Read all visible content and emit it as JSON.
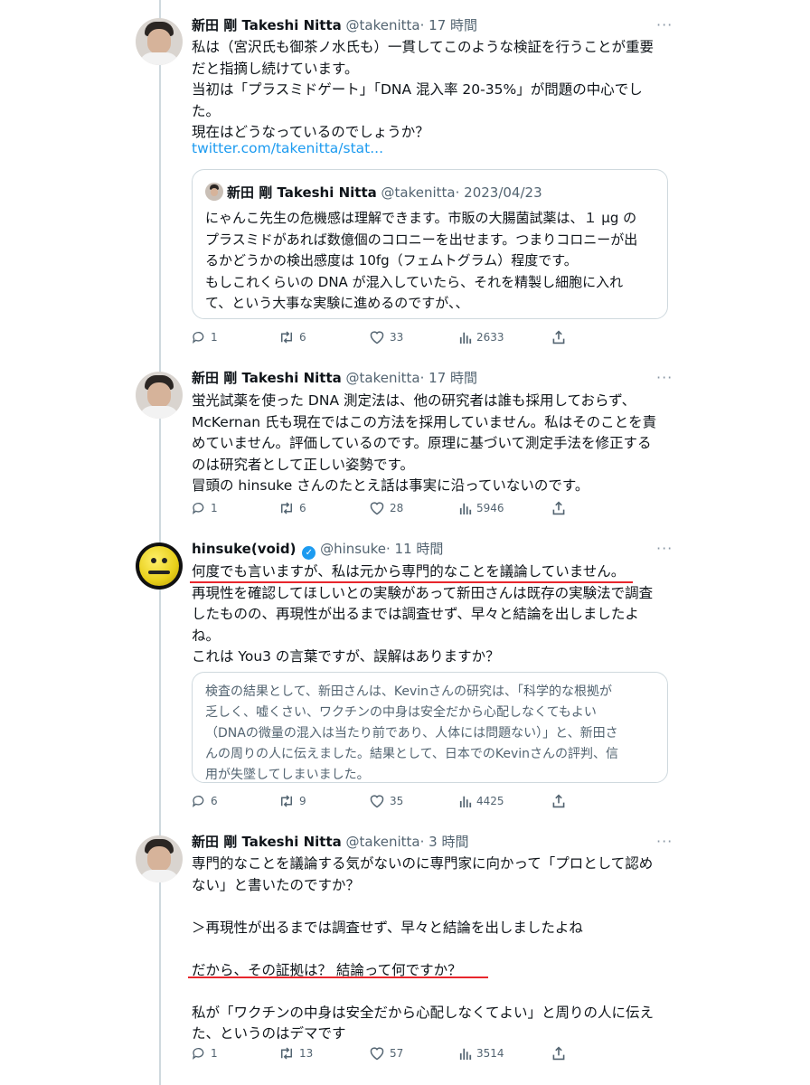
{
  "tweets": [
    {
      "name": "新田 剛 Takeshi Nitta",
      "handle": "@takenitta",
      "time": "· 17 時間",
      "text": "私は（宮沢氏も御茶ノ水氏も）一貫してこのような検証を行うことが重要\nだと指摘し続けています。\n当初は「プラスミドゲート」「DNA 混入率 20-35%」が問題の中心でし\nた。\n現在はどうなっているのでしょうか？",
      "link": "twitter.com/takenitta/stat...",
      "quote": {
        "name": "新田 剛 Takeshi Nitta",
        "handle": "@takenitta",
        "time": "· 2023/04/23",
        "text": "にゃんこ先生の危機感は理解できます。市販の大腸菌試薬は、１ μg の\nプラスミドがあれば数億個のコロニーを出せます。つまりコロニーが出\nるかどうかの検出感度は 10fg（フェムトグラム）程度です。\nもしこれくらいの DNA が混入していたら、それを精製し細胞に入れ\nて、という大事な実験に進めるのですが、、"
      },
      "stats": {
        "replies": "1",
        "retweets": "6",
        "likes": "33",
        "views": "2633"
      }
    },
    {
      "name": "新田 剛 Takeshi Nitta",
      "handle": "@takenitta",
      "time": "· 17 時間",
      "text": "蛍光試薬を使った DNA 測定法は、他の研究者は誰も採用しておらず、\nMcKernan 氏も現在ではこの方法を採用していません。私はそのことを責\nめていません。評価しているのです。原理に基づいて測定手法を修正する\nのは研究者として正しい姿勢です。\n冒頭の hinsuke さんのたとえ話は事実に沿っていないのです。",
      "stats": {
        "replies": "1",
        "retweets": "6",
        "likes": "28",
        "views": "5946"
      }
    },
    {
      "name": "hinsuke(void)",
      "handle": "@hinsuke",
      "time": "· 11 時間",
      "text": "何度でも言いますが、私は元から専門的なことを議論していません。\n再現性を確認してほしいとの実験があって新田さんは既存の実験法で調査\nしたものの、再現性が出るまでは調査せず、早々と結論を出しましたよ\nね。\nこれは You3 の言葉ですが、誤解はありますか？",
      "quote_text": "検査の結果として、新田さんは、Kevinさんの研究は、「科学的な根拠が\n乏しく、嘘くさい、ワクチンの中身は安全だから心配しなくてもよい\n（DNAの微量の混入は当たり前であり、人体には問題ない）」と、新田さ\nんの周りの人に伝えました。結果として、日本でのKevinさんの評判、信\n用が失墜してしまいました。",
      "stats": {
        "replies": "6",
        "retweets": "9",
        "likes": "35",
        "views": "4425"
      }
    },
    {
      "name": "新田 剛 Takeshi Nitta",
      "handle": "@takenitta",
      "time": "· 3 時間",
      "text": "専門的なことを議論する気がないのに専門家に向かって「プロとして認め\nない」と書いたのですか？\n\n＞再現性が出るまでは調査せず、早々と結論を出しましたよね\n\nだから、その証拠は？ 結論って何ですか？\n\n私が「ワクチンの中身は安全だから心配しなくてよい」と周りの人に伝え\nた、というのはデマです",
      "stats": {
        "replies": "1",
        "retweets": "13",
        "likes": "57",
        "views": "3514"
      }
    }
  ],
  "icons": {
    "more": "more-dots-icon",
    "reply": "reply-icon",
    "retweet": "retweet-icon",
    "like": "heart-icon",
    "views": "views-chart-icon",
    "share": "share-icon",
    "verified": "verified-badge-icon"
  },
  "colors": {
    "link": "#1d9bf0",
    "underline": "#e8262c",
    "secondary_text": "#536471",
    "border": "#cfd9de"
  }
}
